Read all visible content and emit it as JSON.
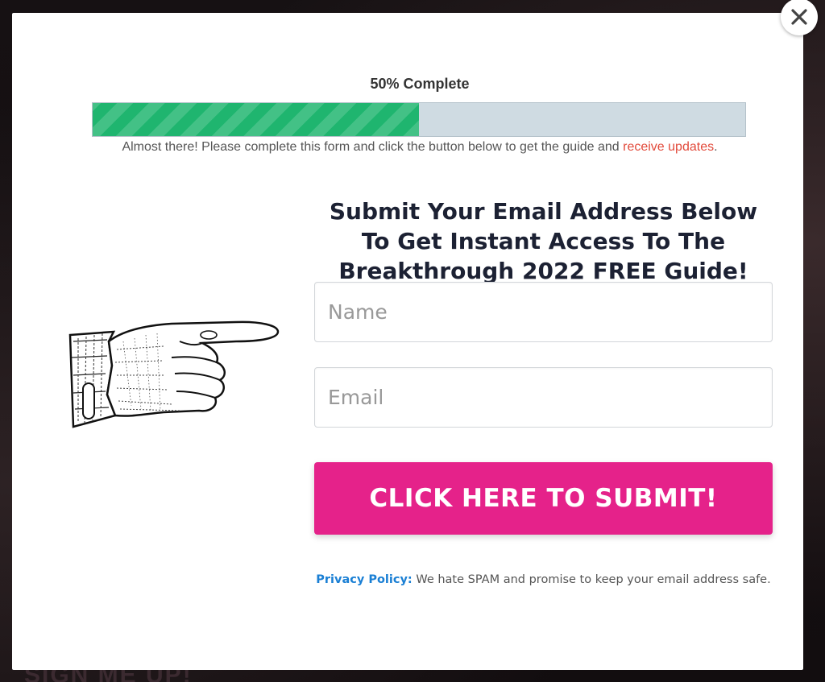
{
  "progress": {
    "label": "50% Complete",
    "percent": 50,
    "fill_color": "#1fb56f",
    "note_text": "Almost there! Please complete this form and click the button below to get the guide and ",
    "note_link": "receive updates",
    "note_end": "."
  },
  "form": {
    "headline": "Submit Your Email Address Below To Get Instant Access To The Breakthrough 2022 FREE Guide!",
    "name_placeholder": "Name",
    "email_placeholder": "Email",
    "submit_label": "CLICK HERE TO SUBMIT!",
    "submit_color": "#e5228a"
  },
  "privacy": {
    "link_label": "Privacy Policy:",
    "text": " We hate SPAM and promise to keep your email address safe."
  },
  "background": {
    "cta_text": "SIGN ME UP!"
  },
  "icons": {
    "close": "close-icon",
    "hand": "pointing-hand-illustration"
  }
}
